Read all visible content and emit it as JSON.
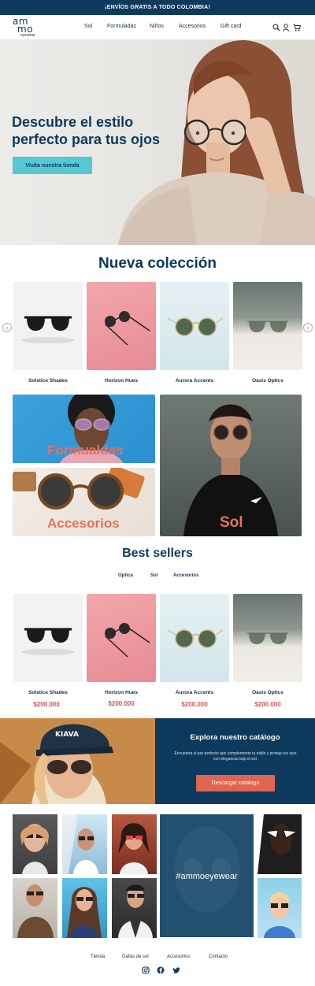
{
  "announcement": "¡ENVÍOS GRATIS A TODO COLOMBIA!",
  "brand": {
    "line1": "am",
    "line2": "mo",
    "line3": "eyewear"
  },
  "nav": [
    "Sol",
    "Formuladas",
    "Niños",
    "Accesorios",
    "Gift card"
  ],
  "header_icons": [
    "search-icon",
    "user-icon",
    "cart-icon"
  ],
  "hero": {
    "title": "Descubre el estilo perfecto para tus ojos",
    "button": "Visita nuestra tienda"
  },
  "new_collection": {
    "title": "Nueva colección",
    "products": [
      "Solstice Shades",
      "Horizon Hues",
      "Aurora Accents",
      "Oasis Optics"
    ]
  },
  "categories": [
    "Formualdas",
    "Accesorios",
    "Sol"
  ],
  "best_sellers": {
    "title": "Best sellers",
    "tabs": [
      "Optica",
      "Sol",
      "Accesorios"
    ],
    "products": [
      {
        "name": "Solstice Shades",
        "price": "$200.000"
      },
      {
        "name": "Horizon Hues",
        "price": "$200.000"
      },
      {
        "name": "Aurora Accents",
        "price": "$200.000"
      },
      {
        "name": "Oasis Optics",
        "price": "$200.000"
      }
    ]
  },
  "promo": {
    "title": "Explora nuestro catálogo",
    "text": "Encuentra el par perfecto que complemente tu estilo y proteja tus ojos con elegancia bajo el sol.",
    "button": "Descargar catalogo"
  },
  "instagram_tag": "#ammoeyewear",
  "footer": {
    "links": [
      "Tienda",
      "Gafas de sol",
      "Accesorios",
      "Contacto"
    ],
    "social": [
      "instagram-icon",
      "facebook-icon",
      "twitter-icon"
    ]
  },
  "colors": {
    "navy": "#0d3a5c",
    "accent": "#56c8d3",
    "coral": "#e06450"
  }
}
